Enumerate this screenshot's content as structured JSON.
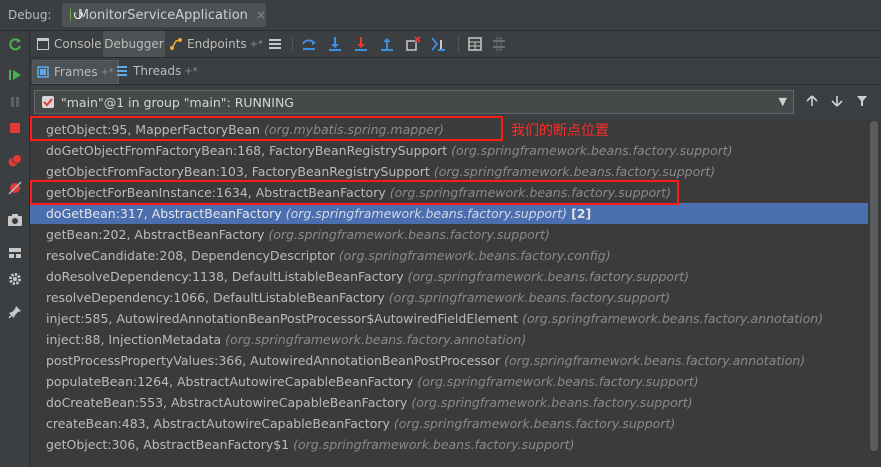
{
  "titlebar": {
    "debug_label": "Debug:",
    "run_config": "MonitorServiceApplication",
    "close_glyph": "×"
  },
  "toolbar": {
    "console_label": "Console",
    "debugger_label": "Debugger",
    "endpoints_label": "Endpoints",
    "pin_glyph": "+*"
  },
  "subtabs": {
    "frames_label": "Frames",
    "threads_label": "Threads",
    "pin_glyph": "+*"
  },
  "thread": {
    "selected": "\"main\"@1 in group \"main\": RUNNING"
  },
  "annotation": {
    "text": "我们的断点位置"
  },
  "colors": {
    "background": "#3c3f41",
    "list_bg": "#3b3b3b",
    "selected_row": "#4b6eaf",
    "highlight_box": "#ff1a1a",
    "resume_green": "#4caf50",
    "stop_red": "#e53935"
  },
  "frames": [
    {
      "method": "getObject:95, MapperFactoryBean",
      "pkg": "(org.mybatis.spring.mapper)",
      "count": ""
    },
    {
      "method": "doGetObjectFromFactoryBean:168, FactoryBeanRegistrySupport",
      "pkg": "(org.springframework.beans.factory.support)",
      "count": ""
    },
    {
      "method": "getObjectFromFactoryBean:103, FactoryBeanRegistrySupport",
      "pkg": "(org.springframework.beans.factory.support)",
      "count": ""
    },
    {
      "method": "getObjectForBeanInstance:1634, AbstractBeanFactory",
      "pkg": "(org.springframework.beans.factory.support)",
      "count": ""
    },
    {
      "method": "doGetBean:317, AbstractBeanFactory",
      "pkg": "(org.springframework.beans.factory.support)",
      "count": "[2]"
    },
    {
      "method": "getBean:202, AbstractBeanFactory",
      "pkg": "(org.springframework.beans.factory.support)",
      "count": ""
    },
    {
      "method": "resolveCandidate:208, DependencyDescriptor",
      "pkg": "(org.springframework.beans.factory.config)",
      "count": ""
    },
    {
      "method": "doResolveDependency:1138, DefaultListableBeanFactory",
      "pkg": "(org.springframework.beans.factory.support)",
      "count": ""
    },
    {
      "method": "resolveDependency:1066, DefaultListableBeanFactory",
      "pkg": "(org.springframework.beans.factory.support)",
      "count": ""
    },
    {
      "method": "inject:585, AutowiredAnnotationBeanPostProcessor$AutowiredFieldElement",
      "pkg": "(org.springframework.beans.factory.annotation)",
      "count": ""
    },
    {
      "method": "inject:88, InjectionMetadata",
      "pkg": "(org.springframework.beans.factory.annotation)",
      "count": ""
    },
    {
      "method": "postProcessPropertyValues:366, AutowiredAnnotationBeanPostProcessor",
      "pkg": "(org.springframework.beans.factory.annotation)",
      "count": ""
    },
    {
      "method": "populateBean:1264, AbstractAutowireCapableBeanFactory",
      "pkg": "(org.springframework.beans.factory.support)",
      "count": ""
    },
    {
      "method": "doCreateBean:553, AbstractAutowireCapableBeanFactory",
      "pkg": "(org.springframework.beans.factory.support)",
      "count": ""
    },
    {
      "method": "createBean:483, AbstractAutowireCapableBeanFactory",
      "pkg": "(org.springframework.beans.factory.support)",
      "count": ""
    },
    {
      "method": "getObject:306, AbstractBeanFactory$1",
      "pkg": "(org.springframework.beans.factory.support)",
      "count": ""
    }
  ]
}
